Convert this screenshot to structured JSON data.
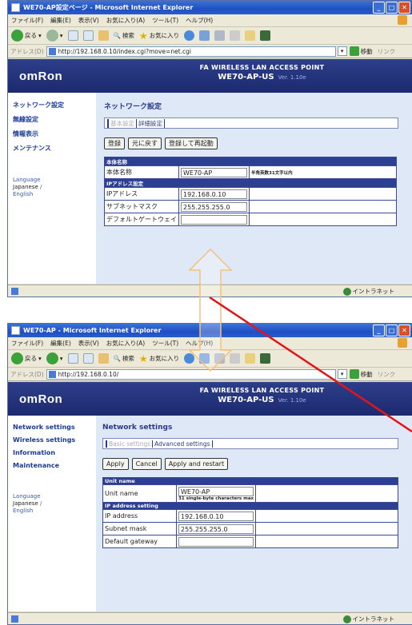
{
  "top": {
    "window_title": "WE70-AP設定ページ - Microsoft Internet Explorer",
    "menu": [
      "ファイル(F)",
      "編集(E)",
      "表示(V)",
      "お気に入り(A)",
      "ツール(T)",
      "ヘルプ(H)"
    ],
    "toolbar": {
      "back": "戻る",
      "search": "検索",
      "favorites": "お気に入り"
    },
    "address": {
      "label": "アドレス(D)",
      "url": "http://192.168.0.10/index.cgi?move=net.cgi",
      "go": "移動",
      "links": "リンク"
    },
    "logo": "omRon",
    "product": {
      "line1": "FA WIRELESS LAN ACCESS POINT",
      "line2": "WE70-AP-US",
      "version": "Ver. 1.10e"
    },
    "nav": [
      "ネットワーク設定",
      "無線設定",
      "情報表示",
      "メンテナンス"
    ],
    "language": {
      "label": "Language",
      "japanese": "Japanese",
      "english": "English"
    },
    "page_title": "ネットワーク設定",
    "tabs": [
      "基本設定",
      "詳細設定"
    ],
    "buttons": [
      "登録",
      "元に戻す",
      "登録して再起動"
    ],
    "table": {
      "sec_unit": "本体名称",
      "unit_name_label": "本体名称",
      "unit_name_value": "WE70-AP",
      "unit_name_note": "半角英数31文字以内",
      "sec_ip": "IPアドレス設定",
      "ip_label": "IPアドレス",
      "ip_value": "192.168.0.10",
      "mask_label": "サブネットマスク",
      "mask_value": "255.255.255.0",
      "gw_label": "デフォルトゲートウェイ",
      "gw_value": ""
    },
    "status_zone": "イントラネット"
  },
  "bottom": {
    "window_title": "WE70-AP - Microsoft Internet Explorer",
    "menu": [
      "ファイル(F)",
      "編集(E)",
      "表示(V)",
      "お気に入り(A)",
      "ツール(T)",
      "ヘルプ(H)"
    ],
    "toolbar": {
      "back": "戻る",
      "search": "検索",
      "favorites": "お気に入り"
    },
    "address": {
      "label": "アドレス(D)",
      "url": "http://192.168.0.10/",
      "go": "移動",
      "links": "リンク"
    },
    "logo": "omRon",
    "product": {
      "line1": "FA WIRELESS LAN ACCESS POINT",
      "line2": "WE70-AP-US",
      "version": "Ver. 1.10e"
    },
    "nav": [
      "Network settings",
      "Wireless settings",
      "Information",
      "Maintenance"
    ],
    "language": {
      "label": "Language",
      "japanese": "Japanese",
      "english": "English"
    },
    "page_title": "Network settings",
    "tabs": [
      "Basic settings",
      "Advanced settings"
    ],
    "buttons": [
      "Apply",
      "Cancel",
      "Apply and restart"
    ],
    "table": {
      "sec_unit": "Unit name",
      "unit_name_label": "Unit name",
      "unit_name_value": "WE70-AP",
      "unit_name_note": "31 single-byte characters max",
      "sec_ip": "IP address setting",
      "ip_label": "IP address",
      "ip_value": "192.168.0.10",
      "mask_label": "Subnet mask",
      "mask_value": "255.255.255.0",
      "gw_label": "Default gateway",
      "gw_value": ""
    },
    "status_zone": "イントラネット"
  },
  "colors": {
    "header": "#1c2a6e",
    "nav": "#1a3a9a",
    "arrow": "#f5c07a",
    "pointer": "#e0161a"
  }
}
